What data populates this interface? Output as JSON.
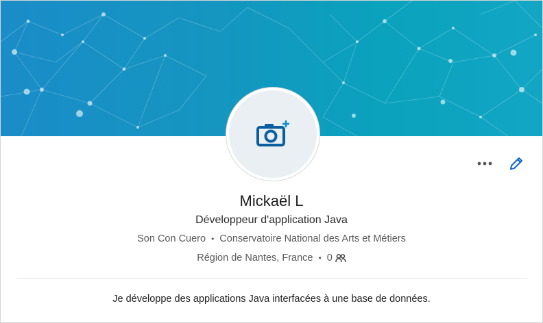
{
  "profile": {
    "name": "Mickaël L",
    "headline": "Développeur d'application Java",
    "company": "Son Con Cuero",
    "school": "Conservatoire National des Arts et Métiers",
    "location": "Région de Nantes, France",
    "connections": "0",
    "separator": "•",
    "summary": "Je développe des applications Java interfacées à une base de données."
  },
  "icons": {
    "avatar": "camera-add-icon",
    "more": "more-dots-icon",
    "edit": "pencil-icon",
    "connections": "people-icon"
  },
  "colors": {
    "banner_start": "#1a8cc8",
    "banner_end": "#12a6c4",
    "accent": "#0a66c2",
    "avatar_bg": "#e9eff3"
  }
}
